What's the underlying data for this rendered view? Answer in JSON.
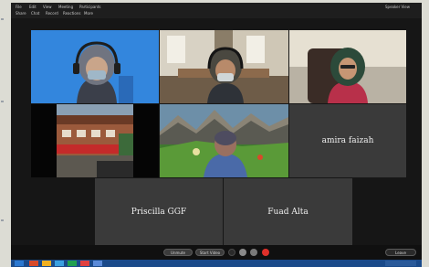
{
  "menubar": {
    "items": [
      "File",
      "Edit",
      "View",
      "Meeting",
      "Participants",
      "Share",
      "Chat",
      "Record",
      "Reactions",
      "More"
    ],
    "top_right": "Speaker View"
  },
  "participants": {
    "tile_7": {
      "name": "amira faizah"
    },
    "tile_8": {
      "name": "Priscilla GGF"
    },
    "tile_9": {
      "name": "Fuad Alta"
    }
  },
  "controls": {
    "mute": "Unmute",
    "video": "Start Video",
    "leave": "Leave"
  },
  "colors": {
    "accent_red": "#e0302a",
    "tile_grey": "#3a3a3a",
    "window_bg": "#161616",
    "taskbar_blue": "#1a4a8a"
  }
}
